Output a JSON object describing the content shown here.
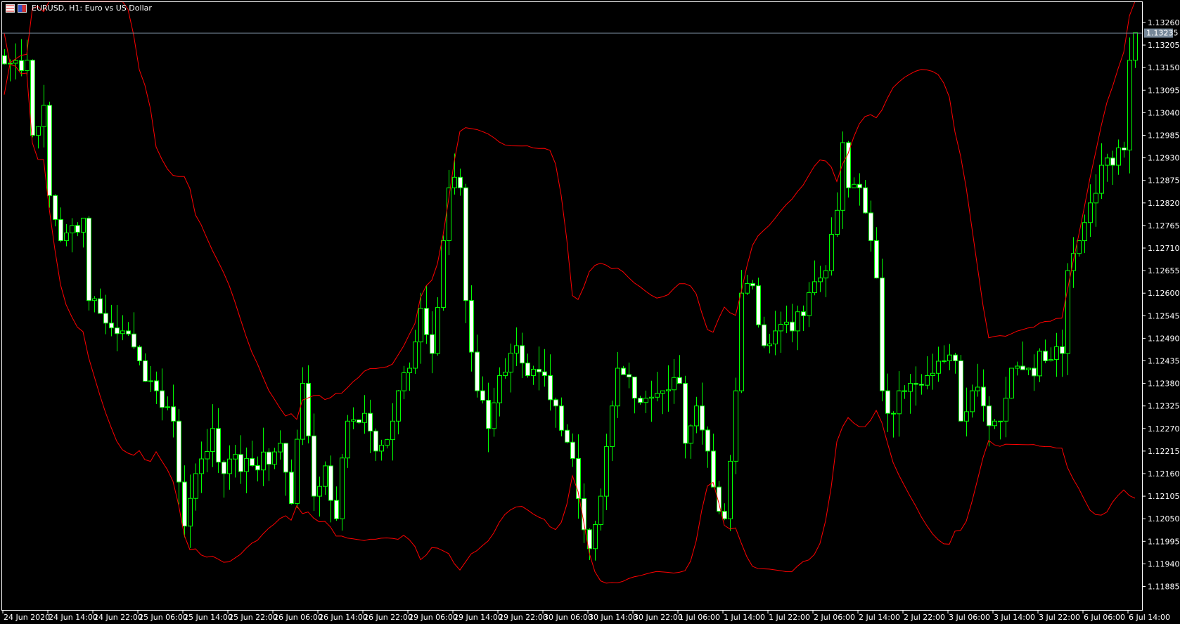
{
  "window": {
    "title": "EURUSD, H1:  Euro vs US Dollar",
    "symbol": "EURUSD",
    "timeframe": "H1"
  },
  "colors": {
    "background": "#000000",
    "bull_line": "#00ff00",
    "bear_body": "#ffffff",
    "indicator": "#ff0000",
    "price_line": "#778899",
    "axis": "#ffffff"
  },
  "icons": [
    "chart-window-icon",
    "symbol-flag-icon"
  ],
  "chart_data": {
    "type": "candlestick",
    "title": "EURUSD, H1:  Euro vs US Dollar",
    "current_price": "1.13235",
    "current_price_value": 1.13235,
    "ylim": [
      1.1185,
      1.1331
    ],
    "price_ticks": [
      "1.13260",
      "1.13205",
      "1.13150",
      "1.13095",
      "1.13040",
      "1.12985",
      "1.12930",
      "1.12875",
      "1.12820",
      "1.12765",
      "1.12710",
      "1.12655",
      "1.12600",
      "1.12545",
      "1.12490",
      "1.12435",
      "1.12380",
      "1.12325",
      "1.12270",
      "1.12215",
      "1.12160",
      "1.12105",
      "1.12050",
      "1.11995",
      "1.11940",
      "1.11885"
    ],
    "time_ticks": [
      "24 Jun 2020",
      "24 Jun 14:00",
      "24 Jun 22:00",
      "25 Jun 06:00",
      "25 Jun 14:00",
      "25 Jun 22:00",
      "26 Jun 06:00",
      "26 Jun 14:00",
      "26 Jun 22:00",
      "29 Jun 06:00",
      "29 Jun 14:00",
      "29 Jun 22:00",
      "30 Jun 06:00",
      "30 Jun 14:00",
      "30 Jun 22:00",
      "1 Jul 06:00",
      "1 Jul 14:00",
      "1 Jul 22:00",
      "2 Jul 06:00",
      "2 Jul 14:00",
      "2 Jul 22:00",
      "3 Jul 06:00",
      "3 Jul 14:00",
      "3 Jul 22:00",
      "6 Jul 06:00",
      "6 Jul 14:00"
    ],
    "bars_per_time_tick": 8,
    "bar_count": 202,
    "approx_close_path": [
      [
        0,
        1.13159
      ],
      [
        4,
        1.13168
      ],
      [
        5,
        1.12985
      ],
      [
        7,
        1.13058
      ],
      [
        8,
        1.12838
      ],
      [
        10,
        1.12728
      ],
      [
        12,
        1.12765
      ],
      [
        14,
        1.12783
      ],
      [
        15,
        1.12582
      ],
      [
        18,
        1.12527
      ],
      [
        21,
        1.12508
      ],
      [
        24,
        1.12435
      ],
      [
        27,
        1.12362
      ],
      [
        30,
        1.12288
      ],
      [
        32,
        1.12032
      ],
      [
        34,
        1.1216
      ],
      [
        37,
        1.1227
      ],
      [
        39,
        1.1216
      ],
      [
        43,
        1.12197
      ],
      [
        45,
        1.12169
      ],
      [
        49,
        1.12234
      ],
      [
        51,
        1.12087
      ],
      [
        53,
        1.1238
      ],
      [
        54,
        1.12252
      ],
      [
        55,
        1.12105
      ],
      [
        57,
        1.12179
      ],
      [
        59,
        1.1205
      ],
      [
        61,
        1.12288
      ],
      [
        64,
        1.12307
      ],
      [
        66,
        1.12215
      ],
      [
        69,
        1.12288
      ],
      [
        70,
        1.12362
      ],
      [
        72,
        1.12417
      ],
      [
        74,
        1.12563
      ],
      [
        76,
        1.12453
      ],
      [
        78,
        1.12728
      ],
      [
        79,
        1.12857
      ],
      [
        81,
        1.12857
      ],
      [
        82,
        1.12582
      ],
      [
        84,
        1.12362
      ],
      [
        86,
        1.1227
      ],
      [
        88,
        1.12399
      ],
      [
        91,
        1.12472
      ],
      [
        93,
        1.12399
      ],
      [
        96,
        1.12399
      ],
      [
        98,
        1.12325
      ],
      [
        101,
        1.12197
      ],
      [
        104,
        1.11977
      ],
      [
        106,
        1.12105
      ],
      [
        108,
        1.12325
      ],
      [
        109,
        1.12417
      ],
      [
        112,
        1.12344
      ],
      [
        114,
        1.12344
      ],
      [
        117,
        1.12362
      ],
      [
        120,
        1.1238
      ],
      [
        121,
        1.12234
      ],
      [
        123,
        1.12325
      ],
      [
        125,
        1.12215
      ],
      [
        127,
        1.12068
      ],
      [
        128,
        1.1205
      ],
      [
        130,
        1.12362
      ],
      [
        131,
        1.126
      ],
      [
        133,
        1.12618
      ],
      [
        135,
        1.12472
      ],
      [
        137,
        1.12508
      ],
      [
        140,
        1.12508
      ],
      [
        142,
        1.12545
      ],
      [
        145,
        1.12637
      ],
      [
        146,
        1.12655
      ],
      [
        148,
        1.12802
      ],
      [
        149,
        1.12967
      ],
      [
        150,
        1.12857
      ],
      [
        152,
        1.12857
      ],
      [
        154,
        1.12728
      ],
      [
        155,
        1.12637
      ],
      [
        156,
        1.12362
      ],
      [
        157,
        1.12307
      ],
      [
        159,
        1.12362
      ],
      [
        161,
        1.1238
      ],
      [
        164,
        1.12399
      ],
      [
        167,
        1.12435
      ],
      [
        169,
        1.12435
      ],
      [
        170,
        1.12288
      ],
      [
        172,
        1.12362
      ],
      [
        174,
        1.12325
      ],
      [
        176,
        1.12288
      ],
      [
        177,
        1.12288
      ],
      [
        179,
        1.12417
      ],
      [
        182,
        1.12417
      ],
      [
        185,
        1.12435
      ],
      [
        188,
        1.12453
      ],
      [
        189,
        1.12655
      ],
      [
        191,
        1.12728
      ],
      [
        193,
        1.1282
      ],
      [
        195,
        1.12912
      ],
      [
        197,
        1.12912
      ],
      [
        199,
        1.12949
      ],
      [
        200,
        1.13168
      ],
      [
        201,
        1.13235
      ]
    ],
    "indicator": {
      "name": "bands",
      "period": 20,
      "deviation": 2.5
    }
  }
}
